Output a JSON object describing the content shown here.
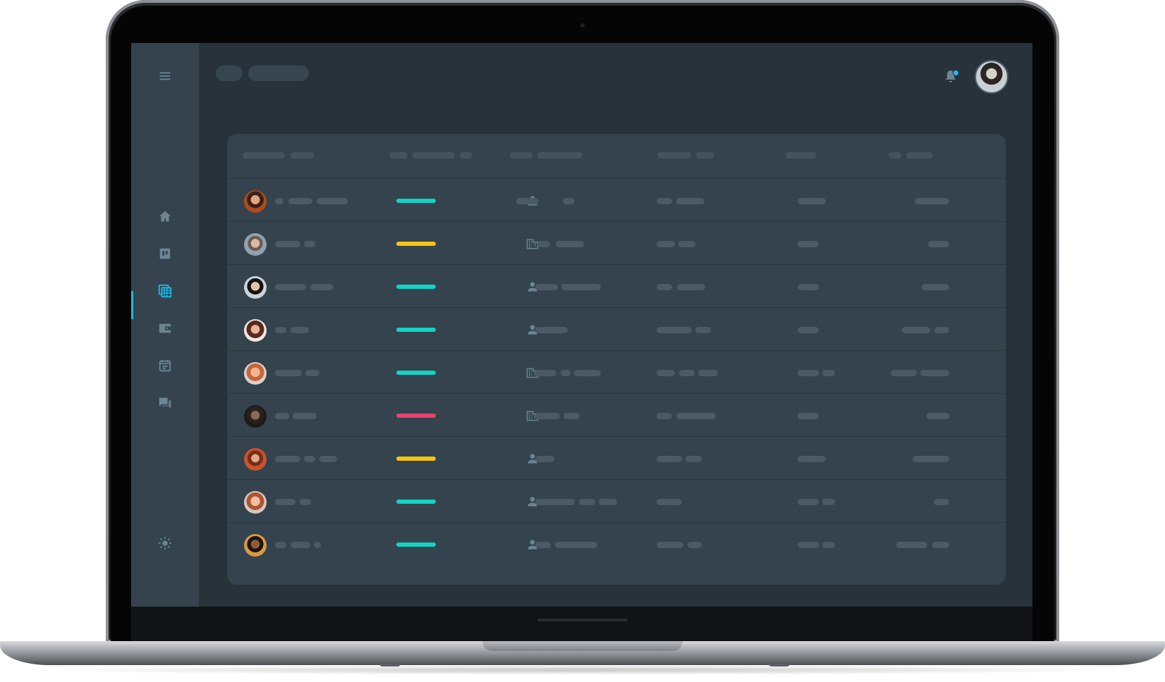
{
  "colors": {
    "screen_bg": "#27323a",
    "panel_bg": "#34434d",
    "placeholder": "#4b5a64",
    "accent": "#22b8e6",
    "teal": "#13d3c4",
    "yellow": "#f6c412",
    "pink": "#ec3f73"
  },
  "sidebar": {
    "items": [
      {
        "icon": "menu-icon",
        "active": false
      },
      {
        "icon": "home-icon",
        "active": false
      },
      {
        "icon": "board-icon",
        "active": false
      },
      {
        "icon": "table-icon",
        "active": true
      },
      {
        "icon": "wallet-icon",
        "active": false
      },
      {
        "icon": "calendar-icon",
        "active": false
      },
      {
        "icon": "chat-icon",
        "active": false
      },
      {
        "icon": "theme-sun-icon",
        "active": false
      }
    ]
  },
  "header": {
    "notification_icon": "bell-icon",
    "has_unread_notifications": true,
    "user_avatar": "user-avatar"
  },
  "table": {
    "rows": [
      {
        "status": "teal",
        "type_icon": "person-icon",
        "dot": "pink"
      },
      {
        "status": "yellow",
        "type_icon": "building-icon",
        "dot": "teal"
      },
      {
        "status": "teal",
        "type_icon": "person-icon",
        "dot": "teal"
      },
      {
        "status": "teal",
        "type_icon": "person-icon",
        "dot": "teal"
      },
      {
        "status": "teal",
        "type_icon": "building-icon",
        "dot": "yellow"
      },
      {
        "status": "pink",
        "type_icon": "building-icon",
        "dot": "teal"
      },
      {
        "status": "yellow",
        "type_icon": "person-icon",
        "dot": "pink"
      },
      {
        "status": "teal",
        "type_icon": "person-icon",
        "dot": "yellow"
      },
      {
        "status": "teal",
        "type_icon": "person-icon",
        "dot": "yellow"
      }
    ]
  }
}
